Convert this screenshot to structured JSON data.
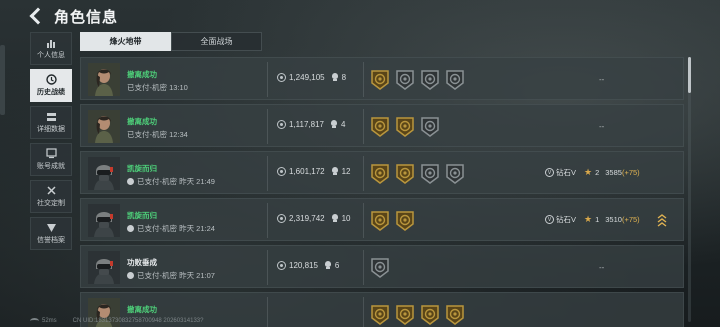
{
  "header": {
    "title": "角色信息"
  },
  "sidebar": {
    "items": [
      {
        "label": "个人信息",
        "icon": "bar-chart-icon",
        "active": false
      },
      {
        "label": "历史战绩",
        "icon": "history-icon",
        "active": true
      },
      {
        "label": "详细数据",
        "icon": "detail-data-icon",
        "active": false
      },
      {
        "label": "账号成就",
        "icon": "achievement-icon",
        "active": false
      },
      {
        "label": "社交定制",
        "icon": "social-custom-icon",
        "active": false
      },
      {
        "label": "信誉档案",
        "icon": "reputation-icon",
        "active": false
      }
    ]
  },
  "tabs": [
    {
      "label": "烽火地带",
      "active": true
    },
    {
      "label": "全面战场",
      "active": false
    }
  ],
  "records": [
    {
      "result": "撤离成功",
      "result_color": "#4ed07a",
      "operator": "female-operator",
      "detail": "已支付-机密 13:10",
      "value": "1,249,105",
      "kills": "8",
      "medals": [
        "gold",
        "silver",
        "silver",
        "silver"
      ],
      "rank": null,
      "extra": "--"
    },
    {
      "result": "撤离成功",
      "result_color": "#4ed07a",
      "operator": "female-operator",
      "detail": "已支付-机密 12:34",
      "value": "1,117,817",
      "kills": "4",
      "medals": [
        "gold",
        "gold",
        "silver"
      ],
      "rank": null,
      "extra": "--"
    },
    {
      "result": "凯旋而归",
      "result_color": "#4ed07a",
      "operator": "helmet-operator",
      "detail": "已支付-机密 昨天 21:49",
      "value": "1,601,172",
      "kills": "12",
      "medals": [
        "gold",
        "gold",
        "silver",
        "silver"
      ],
      "rank": {
        "tier": "钻石V",
        "stars": "2",
        "points": "3585",
        "delta": "(+75)"
      },
      "extra": ""
    },
    {
      "result": "凯旋而归",
      "result_color": "#4ed07a",
      "operator": "helmet-operator",
      "detail": "已支付-机密 昨天 21:24",
      "value": "2,319,742",
      "kills": "10",
      "medals": [
        "gold",
        "gold"
      ],
      "rank": {
        "tier": "钻石V",
        "stars": "1",
        "points": "3510",
        "delta": "(+75)"
      },
      "extra": "chevron"
    },
    {
      "result": "功败垂成",
      "result_color": "#e6e9eb",
      "operator": "helmet-operator",
      "detail": "已支付-机密 昨天 21:07",
      "value": "120,815",
      "kills": "6",
      "medals": [
        "silver"
      ],
      "rank": null,
      "extra": "--"
    },
    {
      "result": "撤离成功",
      "result_color": "#4ed07a",
      "operator": "female-operator",
      "detail": "",
      "value": "",
      "kills": "",
      "medals": [
        "gold",
        "gold",
        "gold",
        "gold"
      ],
      "rank": null,
      "extra": ""
    }
  ],
  "status": {
    "ping": "52ms",
    "uid": "CN UID:18313730832758700948 20260314133?"
  },
  "colors": {
    "gold_medal": "#b9963d",
    "silver_medal": "#8a9194",
    "green": "#4ed07a",
    "accent": "#e0b352"
  }
}
